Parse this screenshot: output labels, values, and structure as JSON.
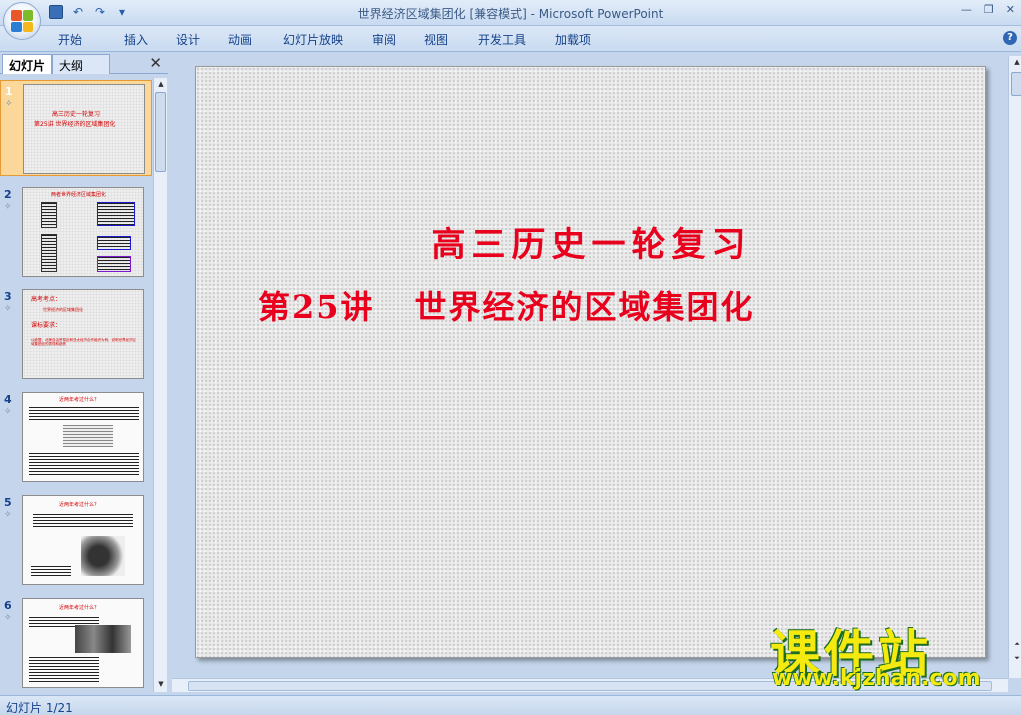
{
  "window": {
    "title": "世界经济区域集团化 [兼容模式] - Microsoft PowerPoint"
  },
  "ribbon": {
    "tabs": [
      "开始",
      "插入",
      "设计",
      "动画",
      "幻灯片放映",
      "审阅",
      "视图",
      "开发工具",
      "加载项"
    ]
  },
  "left_panel": {
    "tab_slides": "幻灯片",
    "tab_outline": "大纲",
    "thumbnails": [
      {
        "num": "1",
        "title": "高三历史一轮复习",
        "subtitle": "第25讲 世界经济的区域集团化"
      },
      {
        "num": "2",
        "title": "两者世界经济区域集团化"
      },
      {
        "num": "3",
        "line1": "高考考点：",
        "line2": "世界经济的区域集团化",
        "line3": "课标要求：",
        "line4": "以欧盟、北美自由贸易区和亚太经济合作组织为例，说明世界经济区域集团化的表现和趋势"
      },
      {
        "num": "4",
        "title": "近两年考过什么？"
      },
      {
        "num": "5",
        "title": "近两年考过什么？"
      },
      {
        "num": "6",
        "title": "近两年考过什么？"
      }
    ],
    "anim_mark": "✧"
  },
  "slide": {
    "title": "高三历史一轮复习",
    "subtitle_a": "第25讲",
    "subtitle_b": "世界经济的区域集团化"
  },
  "watermark": {
    "cn": "课件站",
    "url": "www.kjzhan.com"
  },
  "status": {
    "slide_info": "幻灯片 1/21"
  },
  "colors": {
    "accent_red": "#e8001c",
    "ribbon_text": "#15428b"
  }
}
